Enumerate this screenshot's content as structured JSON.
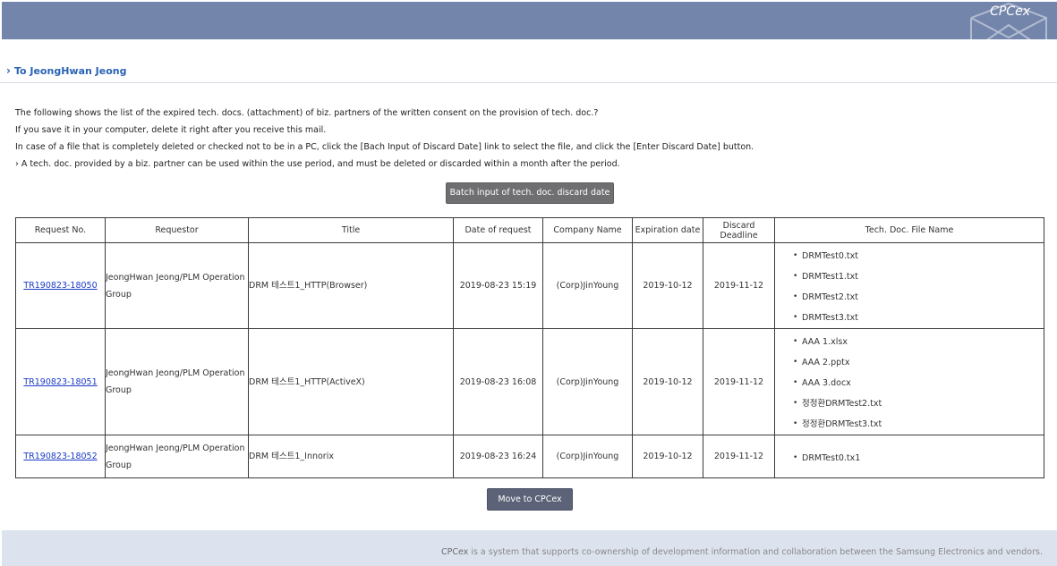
{
  "header": {
    "brand": "CPCex"
  },
  "greeting": "To JeongHwan Jeong",
  "intro": [
    "The following shows the list of the expired tech. docs. (attachment) of biz. partners of the written consent on the provision of tech. doc.?",
    "If you save it in your computer, delete it right after you receive this mail.",
    "In case of a file that is completely deleted or checked not to be in a PC, click the [Bach Input of Discard Date] link to select the file, and click the [Enter Discard Date] button.",
    "› A tech. doc. provided by a biz. partner can be used within the use period, and must be deleted or discarded within a month after the period."
  ],
  "batch_button": "Batch input of tech. doc. discard date",
  "table": {
    "headers": [
      "Request No.",
      "Requestor",
      "Title",
      "Date of request",
      "Company Name",
      "Expiration date",
      "Discard Deadline",
      "Tech. Doc. File Name"
    ],
    "rows": [
      {
        "request_no": "TR190823-18050",
        "requestor": "JeongHwan Jeong/PLM Operation Group",
        "title": "DRM 테스트1_HTTP(Browser)",
        "date_of_request": "2019-08-23 15:19",
        "company": "(Corp)JinYoung",
        "expiration": "2019-10-12",
        "discard_deadline": "2019-11-12",
        "files": [
          "DRMTest0.txt",
          "DRMTest1.txt",
          "DRMTest2.txt",
          "DRMTest3.txt"
        ]
      },
      {
        "request_no": "TR190823-18051",
        "requestor": "JeongHwan Jeong/PLM Operation Group",
        "title": "DRM 테스트1_HTTP(ActiveX)",
        "date_of_request": "2019-08-23 16:08",
        "company": "(Corp)JinYoung",
        "expiration": "2019-10-12",
        "discard_deadline": "2019-11-12",
        "files": [
          "AAA 1.xlsx",
          "AAA 2.pptx",
          "AAA 3.docx",
          "정정환DRMTest2.txt",
          "정정환DRMTest3.txt"
        ]
      },
      {
        "request_no": "TR190823-18052",
        "requestor": "JeongHwan Jeong/PLM Operation Group",
        "title": "DRM 테스트1_Innorix",
        "date_of_request": "2019-08-23 16:24",
        "company": "(Corp)JinYoung",
        "expiration": "2019-10-12",
        "discard_deadline": "2019-11-12",
        "files": [
          "DRMTest0.tx1"
        ]
      }
    ]
  },
  "move_button": "Move to CPCex",
  "footer": {
    "brand": "CPCex",
    "text": " is a system that supports co-ownership of development information and collaboration between the Samsung Electronics and vendors."
  },
  "colors": {
    "header_bar": "#7485ab",
    "link": "#1a3cc5",
    "greeting": "#2a63b4",
    "footer_bg": "#dde3ee"
  }
}
